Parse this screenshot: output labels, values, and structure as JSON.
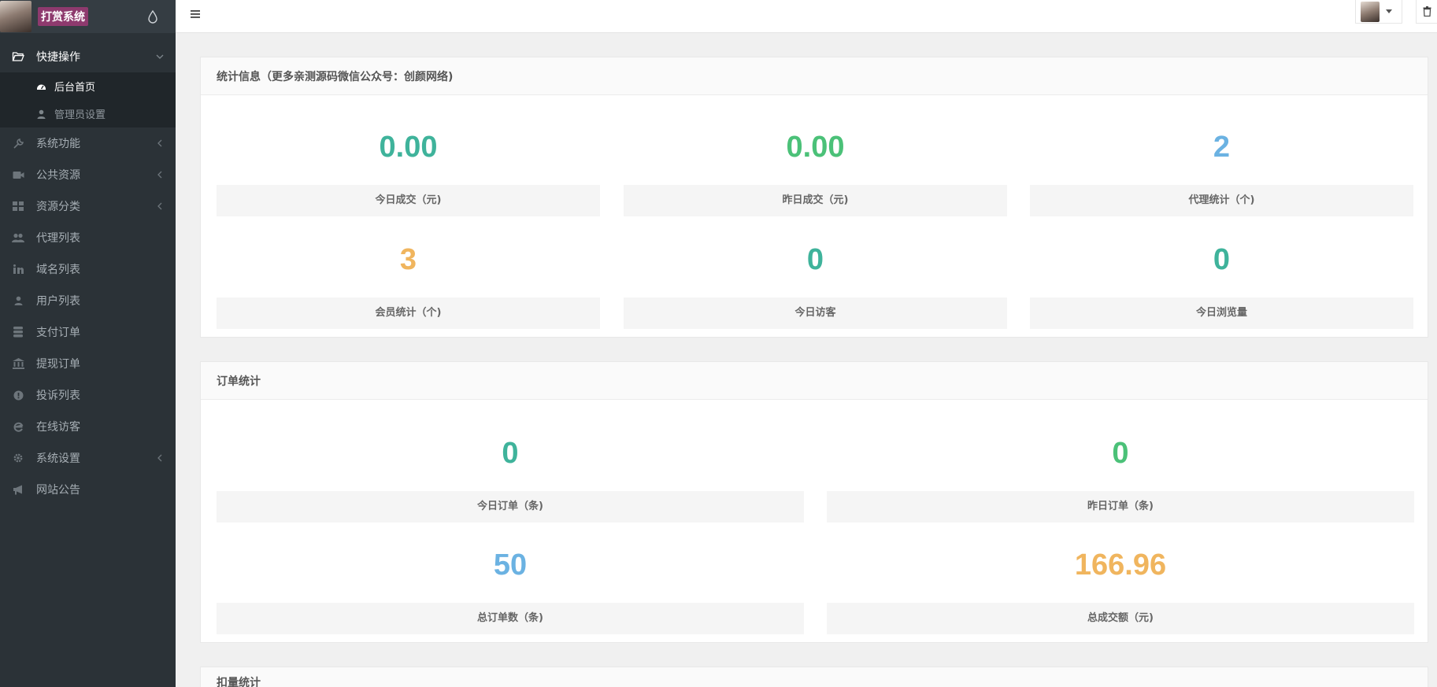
{
  "sidebar": {
    "brand": "打赏系统",
    "sections": [
      {
        "label": "快捷操作",
        "icon": "folder-open-icon",
        "expanded": true,
        "children": [
          {
            "label": "后台首页",
            "icon": "dashboard-icon",
            "active": true
          },
          {
            "label": "管理员设置",
            "icon": "user-icon",
            "active": false
          }
        ]
      },
      {
        "label": "系统功能",
        "icon": "wrench-icon",
        "has_children": true
      },
      {
        "label": "公共资源",
        "icon": "video-camera-icon",
        "has_children": true
      },
      {
        "label": "资源分类",
        "icon": "grid-icon",
        "has_children": true
      },
      {
        "label": "代理列表",
        "icon": "users-icon"
      },
      {
        "label": "域名列表",
        "icon": "linkedin-icon"
      },
      {
        "label": "用户列表",
        "icon": "user-icon"
      },
      {
        "label": "支付订单",
        "icon": "database-icon"
      },
      {
        "label": "提现订单",
        "icon": "bank-icon"
      },
      {
        "label": "投诉列表",
        "icon": "exclamation-circle-icon"
      },
      {
        "label": "在线访客",
        "icon": "ie-icon"
      },
      {
        "label": "系统设置",
        "icon": "gear-icon",
        "has_children": true
      },
      {
        "label": "网站公告",
        "icon": "bullhorn-icon"
      }
    ]
  },
  "panel1": {
    "title": "统计信息（更多亲测源码微信公众号：创颜网络)",
    "stats": [
      {
        "value": "0.00",
        "label": "今日成交（元)",
        "color": "#3fb39b"
      },
      {
        "value": "0.00",
        "label": "昨日成交（元)",
        "color": "#4bc178"
      },
      {
        "value": "2",
        "label": "代理统计（个)",
        "color": "#6bb2e2"
      },
      {
        "value": "3",
        "label": "会员统计（个)",
        "color": "#f0b55e"
      },
      {
        "value": "0",
        "label": "今日访客",
        "color": "#3fb39b"
      },
      {
        "value": "0",
        "label": "今日浏览量",
        "color": "#3fb39b"
      }
    ]
  },
  "panel2": {
    "title": "订单统计",
    "stats": [
      {
        "value": "0",
        "label": "今日订单（条)",
        "color": "#3fb39b"
      },
      {
        "value": "0",
        "label": "昨日订单（条)",
        "color": "#4bc178"
      },
      {
        "value": "50",
        "label": "总订单数（条)",
        "color": "#6bb2e2"
      },
      {
        "value": "166.96",
        "label": "总成交额（元)",
        "color": "#f0b55e"
      }
    ]
  },
  "panel3": {
    "title": "扣量统计"
  }
}
